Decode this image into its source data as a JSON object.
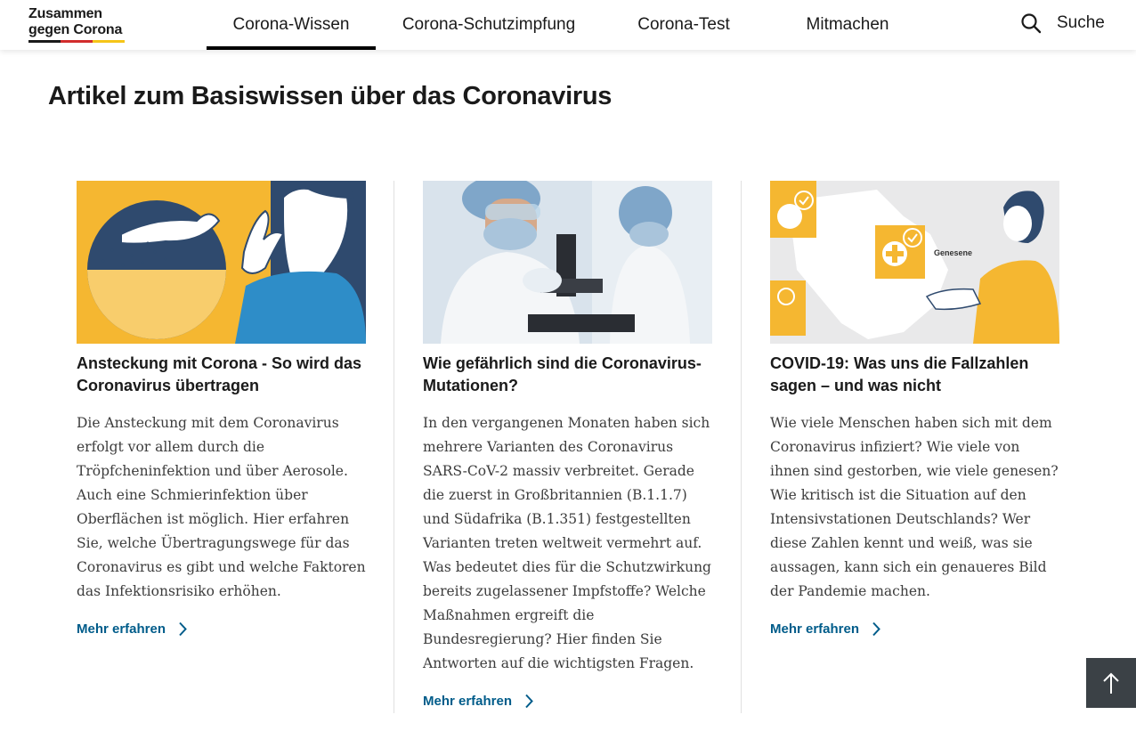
{
  "logo": {
    "line1": "Zusammen",
    "line2": "gegen Corona",
    "colors": [
      "#1a1a1a",
      "#d22d2d",
      "#f5c518"
    ]
  },
  "nav": {
    "items": [
      {
        "label": "Corona-Wissen",
        "active": true
      },
      {
        "label": "Corona-Schutzimpfung",
        "active": false
      },
      {
        "label": "Corona-Test",
        "active": false
      },
      {
        "label": "Mitmachen",
        "active": false
      }
    ],
    "search_label": "Suche"
  },
  "page_title": "Artikel zum Basiswissen über das Coronavirus",
  "cards": [
    {
      "image": "illustration-droplet-infection",
      "title": "Ansteckung mit Corona - So wird das Coronavirus übertragen",
      "text": "Die Ansteckung mit dem Coronavirus erfolgt vor allem durch die Tröpfcheninfektion und über Aerosole. Auch eine Schmierinfektion über Oberflächen ist möglich. Hier erfahren Sie, welche Übertragungswege für das Coronavirus es gibt und welche Faktoren das Infektionsrisiko erhöhen.",
      "link": "Mehr erfahren"
    },
    {
      "image": "photo-lab-scientists-microscope",
      "title": "Wie gefährlich sind die Coronavirus-Mutationen?",
      "text": "In den vergangenen Monaten haben sich mehrere Varianten des Coronavirus SARS-CoV-2 massiv verbreitet. Gerade die zuerst in Großbritannien (B.1.1.7) und Südafrika (B.1.351) festgestellten Varianten treten weltweit vermehrt auf. Was bedeutet dies für die Schutzwirkung bereits zugelassener Impfstoffe? Welche Maßnahmen ergreift die Bundesregierung? Hier finden Sie Antworten auf die wichtigsten Fragen.",
      "link": "Mehr erfahren"
    },
    {
      "image": "illustration-germany-map-statistics",
      "image_label": "Genesene",
      "title": "COVID-19: Was uns die Fallzahlen sagen – und was nicht",
      "text": "Wie viele Menschen haben sich mit dem Coronavirus infiziert? Wie viele von ihnen sind gestorben, wie viele genesen? Wie kritisch ist die Situation auf den Intensivstationen Deutschlands? Wer diese Zahlen kennt und weiß, was sie aussagen, kann sich ein genaueres Bild der Pandemie machen.",
      "link": "Mehr erfahren"
    }
  ],
  "colors": {
    "link": "#005c8a",
    "accent_yellow": "#f5b731",
    "navy": "#2f4a6e",
    "back_to_top_bg": "#3b4146"
  },
  "icons": {
    "search": "search-icon",
    "chevron": "chevron-right-icon",
    "back_to_top": "arrow-up-icon"
  }
}
